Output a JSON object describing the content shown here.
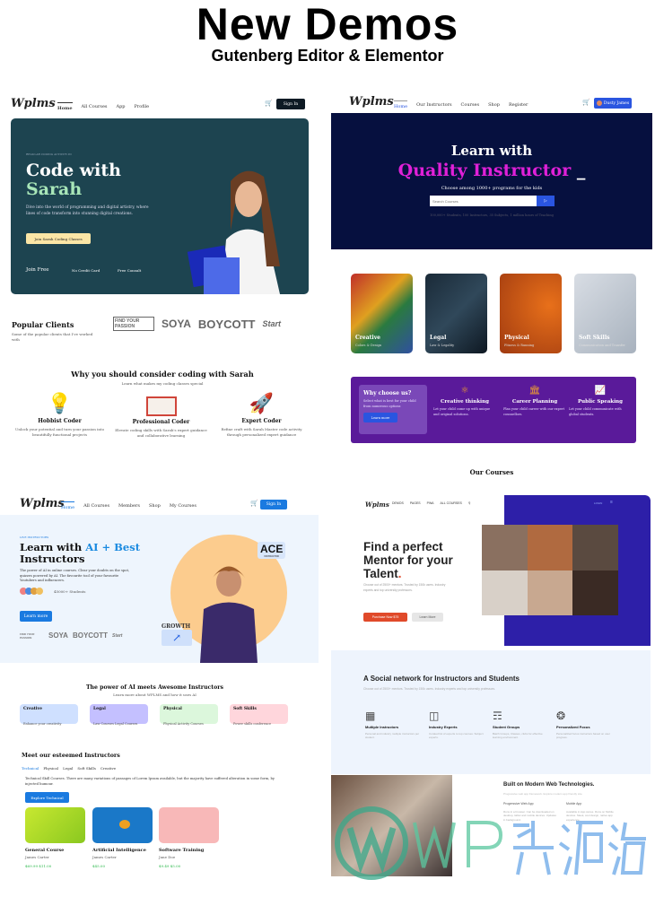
{
  "header": {
    "title": "New Demos",
    "subtitle": "Gutenberg Editor & Elementor"
  },
  "watermark": {
    "text": "WP资源海"
  },
  "demo1": {
    "logo": "Wplms",
    "nav": [
      "Home",
      "All Courses",
      "App",
      "Profile"
    ],
    "signin": "Sign In",
    "hero": {
      "eyebrow": "REGULAR CODING ACTIVITY IN",
      "title1": "Code with",
      "title2": "Sarah",
      "desc": "Dive into the world of programming and digital artistry, where lines of code transform into stunning digital creations.",
      "cta": "Join Sarah Coding Classes",
      "perks": [
        "Join Free",
        "No Credit Card",
        "Free Consult"
      ],
      "bg": "#1d4450",
      "accent": "#a8e6b8"
    },
    "clients": {
      "title": "Popular Clients",
      "desc": "Some of the popular clients that I've worked with",
      "logos": [
        "FIND YOUR PASSION",
        "SOYA",
        "BOYCOTT",
        "Start"
      ]
    },
    "why": {
      "title": "Why you should consider coding with Sarah",
      "subtitle": "Learn what makes my coding classes special",
      "items": [
        {
          "icon": "lightbulb-icon",
          "title": "Hobbist Coder",
          "desc": "Unlock your potential and turn your passion into beautifully functional projects"
        },
        {
          "icon": "notebook-icon",
          "title": "Professional Coder",
          "desc": "Elevate coding skills with Sarah's expert guidance and collaborative learning"
        },
        {
          "icon": "rocket-icon",
          "title": "Expert Coder",
          "desc": "Refine craft with Sarah Master code activity through personalized expert guidance"
        }
      ]
    }
  },
  "demo2": {
    "logo": "Wplms",
    "nav": [
      "Home",
      "Our Instructors",
      "Courses",
      "Shop",
      "Register"
    ],
    "user": "Dusty James",
    "hero": {
      "title1": "Learn with",
      "title2": "Quality Instructor",
      "subtitle": "Choose among 1000+ programs for the kids",
      "search_placeholder": "Search Courses",
      "stats": "100,000+ Students, 100 Instructors, 35 Subjects, 1 million hours of Teaching",
      "bg": "#06103f",
      "accent": "#e020d8"
    },
    "cards": [
      {
        "title": "Creative",
        "sub": "Colors & Design"
      },
      {
        "title": "Legal",
        "sub": "Law & Legality"
      },
      {
        "title": "Physical",
        "sub": "Fitness & Running"
      },
      {
        "title": "Soft Skills",
        "sub": "Communication and Transfer"
      }
    ],
    "why": {
      "title": "Why choose us?",
      "desc": "Select what is best for your child from numerous options",
      "cta": "Learn more",
      "items": [
        {
          "icon": "atom-icon",
          "title": "Creative thinking",
          "desc": "Let your child come up with unique and original solutions."
        },
        {
          "icon": "bank-icon",
          "title": "Career Planning",
          "desc": "Plan your child career with our expert counsellors."
        },
        {
          "icon": "chart-icon",
          "title": "Public Speaking",
          "desc": "Let your child communicate with global students."
        }
      ],
      "bg": "#5a1a9a"
    },
    "courses_title": "Our Courses"
  },
  "demo3": {
    "logo": "Wplms",
    "nav": [
      "Home",
      "All Courses",
      "Members",
      "Shop",
      "My Courses"
    ],
    "signin": "Sign In",
    "hero": {
      "eyebrow": "LIVE INSTRUCTORS",
      "title1": "Learn with ",
      "title_accent": "AI + Best",
      "title2": "Instructors",
      "desc": "The power of AI in online courses. Clear your doubts on the spot, quizzes powered by AI. The favourite tool of your favourite Youtubers and influencers.",
      "students": "45000+ Students",
      "cta": "Learn more",
      "badge1": "ACE",
      "badge1_sub": "INSTRUCTOR",
      "badge2": "GROWTH",
      "logos": [
        "FIND YOUR PASSION",
        "SOYA",
        "BOYCOTT",
        "Start"
      ]
    },
    "power": {
      "title": "The power of AI meets Awesome Instructors",
      "subtitle": "Learn more about WPLMS and how it uses AI",
      "cats": [
        {
          "title": "Creative",
          "sub": "Enhance your creativity",
          "bg": "#cfe0ff"
        },
        {
          "title": "Legal",
          "sub": "Law Courses Legal Courses",
          "bg": "#c4c0ff"
        },
        {
          "title": "Physical",
          "sub": "Physical Activity Courses",
          "bg": "#dcf7dc"
        },
        {
          "title": "Soft Skills",
          "sub": "Power skills conference",
          "bg": "#ffd6dc"
        }
      ]
    },
    "instructors": {
      "title": "Meet our esteemed Instructors",
      "tabs": [
        "Technical",
        "Physical",
        "Legal",
        "Soft Skills",
        "Creative"
      ],
      "desc": "Technical Skill Courses. There are many variations of passages of Lorem Ipsum available, but the majority have suffered alteration in some form, by injected humour.",
      "cta": "Explore Technical",
      "courses": [
        {
          "title": "General Course",
          "author": "James Carter",
          "price": "$69.99 $11.00"
        },
        {
          "title": "Artificial Intelligence",
          "author": "James Carter",
          "price": "$45.00"
        },
        {
          "title": "Software Training",
          "author": "Jane Doe",
          "price": "$9.49 $5.00"
        }
      ]
    }
  },
  "demo4": {
    "logo": "Wplms",
    "nav": [
      "DEMOS",
      "PAGES",
      "PWA",
      "ALL COURSES"
    ],
    "login": "LOGIN",
    "hero": {
      "title1": "Find a perfect",
      "title2": "Mentor for your",
      "title3": "Talent",
      "dot": ".",
      "desc": "Choose out of 2500+ mentors. Trusted by 150k users. Industry experts and top university professors.",
      "cta1": "Purchase Now $75",
      "cta2": "Learn More",
      "bg": "#2d1fa8",
      "accent": "#e04a2a"
    },
    "social": {
      "title": "A Social network for Instructors and Students",
      "desc": "Choose out of 2500+ mentors. Trusted by 150k users. Industry experts and top university professors.",
      "items": [
        {
          "icon": "whiteboard-icon",
          "title": "Multiple Instructors",
          "desc": "Personal and industry multiple instructors per student."
        },
        {
          "icon": "presentation-icon",
          "title": "Industry Experts",
          "desc": "Curated list of experts to top courses. Subject experts."
        },
        {
          "icon": "group-icon",
          "title": "Student Groups",
          "desc": "Batch Groups, Classes, clubs for effective learning environment."
        },
        {
          "icon": "focus-icon",
          "title": "Personalized Focus",
          "desc": "Personalized focus instructors based on user progress."
        }
      ]
    },
    "tech": {
      "title": "Built on Modern Web Technologies.",
      "desc": "Progressive web app framework. Explore modern app friendly site.",
      "col1_title": "Progressive Web App",
      "col1_desc": "Runs in a browser. Can be downloaded on desktop, tablet and mobile devices. Updates in background.",
      "col2_title": "Mobile App",
      "col2_desc": "Available in App stores. Runs on Mobile devices. Sleek, cool design, native app experience."
    }
  }
}
